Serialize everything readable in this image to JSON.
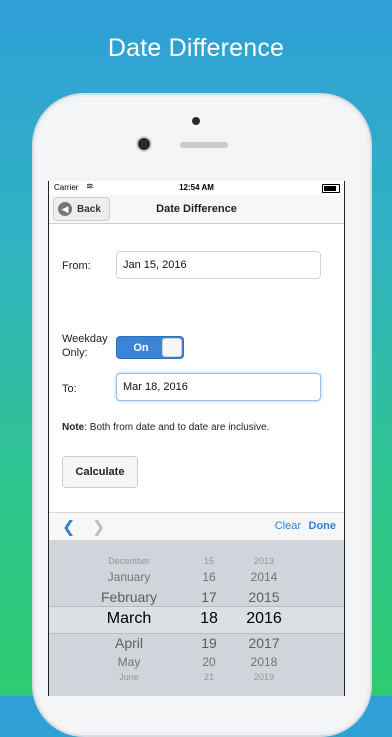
{
  "headline": "Date Difference",
  "status": {
    "carrier": "Carrier",
    "time": "12:54 AM"
  },
  "navbar": {
    "back_label": "Back",
    "title": "Date Difference"
  },
  "form": {
    "from_label": "From:",
    "from_value": "Jan 15, 2016",
    "weekday_label_line1": "Weekday",
    "weekday_label_line2": "Only:",
    "toggle_label": "On",
    "to_label": "To:",
    "to_value": "Mar 18, 2016",
    "note_bold": "Note",
    "note_text": ": Both from date and to date are inclusive.",
    "calculate_label": "Calculate"
  },
  "toolbar": {
    "prev_icon": "chevron-left-icon",
    "next_icon": "chevron-right-icon",
    "clear_label": "Clear",
    "done_label": "Done"
  },
  "picker": {
    "months": [
      "December",
      "January",
      "February",
      "March",
      "April",
      "May",
      "June"
    ],
    "days": [
      "15",
      "16",
      "17",
      "18",
      "19",
      "20",
      "21"
    ],
    "years": [
      "2013",
      "2014",
      "2015",
      "2016",
      "2017",
      "2018",
      "2019"
    ],
    "selected": {
      "month": "March",
      "day": "18",
      "year": "2016"
    }
  }
}
